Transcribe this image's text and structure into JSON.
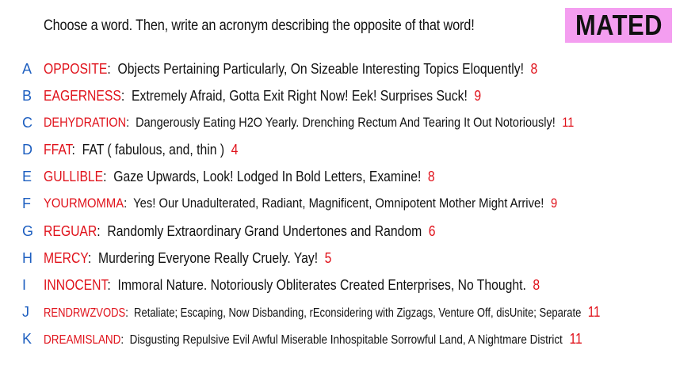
{
  "prompt": "Choose a word. Then, write an acronym describing the opposite of that word!",
  "brand": "MATED",
  "colors": {
    "word": "#e0121b",
    "letter": "#1e5fc0",
    "brand_bg": "#f49ef0"
  },
  "entries": [
    {
      "letter": "A",
      "word": "OPPOSITE",
      "definition": "Objects Pertaining Particularly, On Sizeable Interesting Topics Eloquently!",
      "count": "8"
    },
    {
      "letter": "B",
      "word": "EAGERNESS",
      "definition": "Extremely Afraid, Gotta Exit Right Now! Eek! Surprises Suck!",
      "count": "9"
    },
    {
      "letter": "C",
      "word": "DEHYDRATION",
      "definition": "Dangerously Eating H2O Yearly. Drenching Rectum And Tearing It Out Notoriously!",
      "count": "11"
    },
    {
      "letter": "D",
      "word": "FFAT",
      "definition": "FAT ( fabulous, and, thin )",
      "count": "4"
    },
    {
      "letter": "E",
      "word": "GULLIBLE",
      "definition": "Gaze Upwards, Look! Lodged In Bold Letters, Examine!",
      "count": "8"
    },
    {
      "letter": "F",
      "word": "YOURMOMMA",
      "definition": "Yes! Our Unadulterated, Radiant, Magnificent, Omnipotent Mother Might Arrive!",
      "count": "9"
    },
    {
      "letter": "G",
      "word": "REGUAR",
      "definition": "Randomly Extraordinary Grand Undertones and Random",
      "count": "6"
    },
    {
      "letter": "H",
      "word": "MERCY",
      "definition": "Murdering Everyone Really Cruely. Yay!",
      "count": "5"
    },
    {
      "letter": "I",
      "word": "INNOCENT",
      "definition": "Immoral Nature. Notoriously Obliterates Created Enterprises, No Thought.",
      "count": "8"
    },
    {
      "letter": "J",
      "word": "RENDRWZVODS",
      "definition": "Retaliate; Escaping, Now Disbanding, rEconsidering with Zigzags, Venture Off, disUnite; Separate",
      "count": "11"
    },
    {
      "letter": "K",
      "word": "DREAMISLAND",
      "definition": "Disgusting Repulsive Evil Awful Miserable Inhospitable Sorrowful Land, A Nightmare District",
      "count": "11"
    }
  ]
}
